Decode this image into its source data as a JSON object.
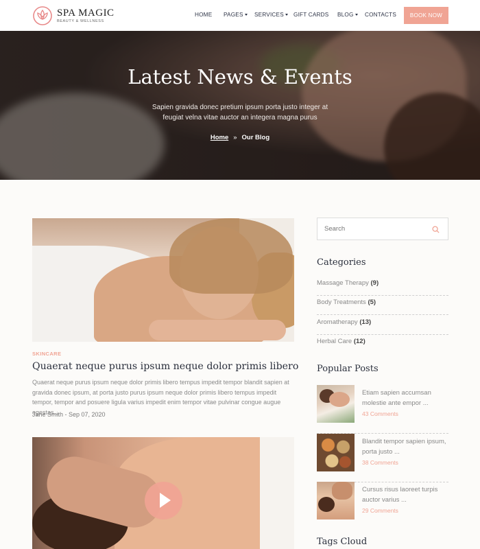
{
  "brand": {
    "name": "SPA MAGIC",
    "tagline": "BEAUTY & WELLNESS"
  },
  "nav": {
    "items": [
      "HOME",
      "PAGES",
      "SERVICES",
      "GIFT CARDS",
      "BLOG",
      "CONTACTS"
    ],
    "book_label": "BOOK NOW"
  },
  "hero": {
    "title": "Latest News & Events",
    "subtitle_line1": "Sapien gravida donec pretium ipsum porta justo integer at",
    "subtitle_line2": "feugiat velna vitae auctor an integera magna purus",
    "breadcrumb": [
      "Home",
      "»",
      "Our Blog"
    ]
  },
  "post1": {
    "category": "SKINCARE",
    "title": "Quaerat neque purus ipsum neque dolor primis libero",
    "excerpt": "Quaerat neque purus ipsum neque dolor primis libero tempus impedit tempor blandit sapien at gravida donec ipsum, at porta justo purus ipsum neque dolor primis libero tempus impedit tempor, tempor and posuere ligula varius impedit enim tempor vitae pulvinar congue augue egestas...",
    "meta": "Jane Smith - Sep 07, 2020"
  },
  "sidebar": {
    "search_placeholder": "Search",
    "categories_heading": "Categories",
    "categories": [
      {
        "name": "Massage Therapy",
        "count": "(9)"
      },
      {
        "name": "Body Treatments",
        "count": "(5)"
      },
      {
        "name": "Aromatherapy",
        "count": "(13)"
      },
      {
        "name": "Herbal Care",
        "count": "(12)"
      }
    ],
    "popular_heading": "Popular Posts",
    "popular": [
      {
        "title": "Etiam sapien accumsan molestie ante empor ...",
        "comments": "43 Comments"
      },
      {
        "title": "Blandit tempor sapien ipsum, porta justo ...",
        "comments": "38 Comments"
      },
      {
        "title": "Cursus risus laoreet turpis auctor varius ...",
        "comments": "29 Comments"
      }
    ],
    "tags_heading": "Tags Cloud"
  },
  "colors": {
    "accent": "#f0a494",
    "heading": "#2a2f3c",
    "nav": "#2e3447",
    "muted": "#888888"
  },
  "icons": {
    "search": "search-icon",
    "play": "play-icon",
    "logo": "lotus-icon"
  }
}
